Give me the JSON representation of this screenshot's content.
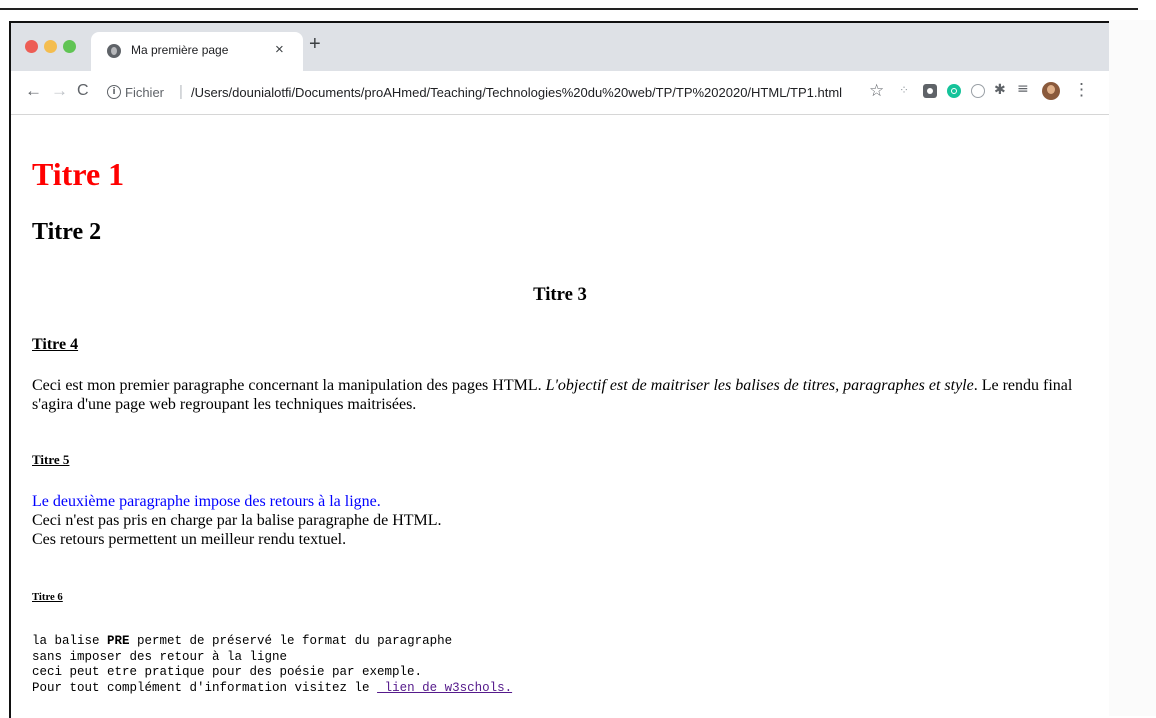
{
  "browser": {
    "tab": {
      "title": "Ma première page",
      "close_label": "×"
    },
    "new_tab_label": "+",
    "toolbar": {
      "back_label": "←",
      "forward_label": "→",
      "reload_label": "C",
      "url_scheme": "Fichier",
      "url_separator": "|",
      "url_path": "/Users/dounialotfi/Documents/proAHmed/Teaching/Technologies%20du%20web/TP/TP%202020/HTML/TP1.html",
      "bookmark_label": "☆",
      "menu_label": "⋮"
    },
    "colors": {
      "red": "#ed5d55",
      "yellow": "#f4bd4f",
      "green": "#60c454"
    }
  },
  "page": {
    "h1": "Titre 1",
    "h2": "Titre 2",
    "h3": "Titre 3",
    "h4": "Titre 4",
    "p1": {
      "start": "Ceci est mon premier paragraphe concernant la manipulation des pages HTML. ",
      "italic": "L'objectif est de maitriser les balises de titres, paragraphes et style",
      "end": ". Le rendu final s'agira d'une page web regroupant les techniques maitrisées."
    },
    "h5": "Titre 5",
    "p2": {
      "line1": "Le deuxième paragraphe impose des retours à la ligne.",
      "line2": "Ceci n'est pas pris en charge par la balise paragraphe de HTML.",
      "line3": "Ces retours permettent un meilleur rendu textuel."
    },
    "h6": "Titre 6",
    "pre": {
      "l1_a": "la balise ",
      "l1_b": "PRE",
      "l1_c": " permet de préservé le format du paragraphe",
      "l2": "sans imposer des retour à la ligne",
      "l3": "ceci peut etre pratique pour des poésie par exemple.",
      "l4": "Pour tout complément d'information visitez le ",
      "link": " lien de w3schols."
    },
    "colors": {
      "h1": "#ff0000",
      "p2_line1": "#0000ff",
      "link": "#551a8b"
    }
  }
}
